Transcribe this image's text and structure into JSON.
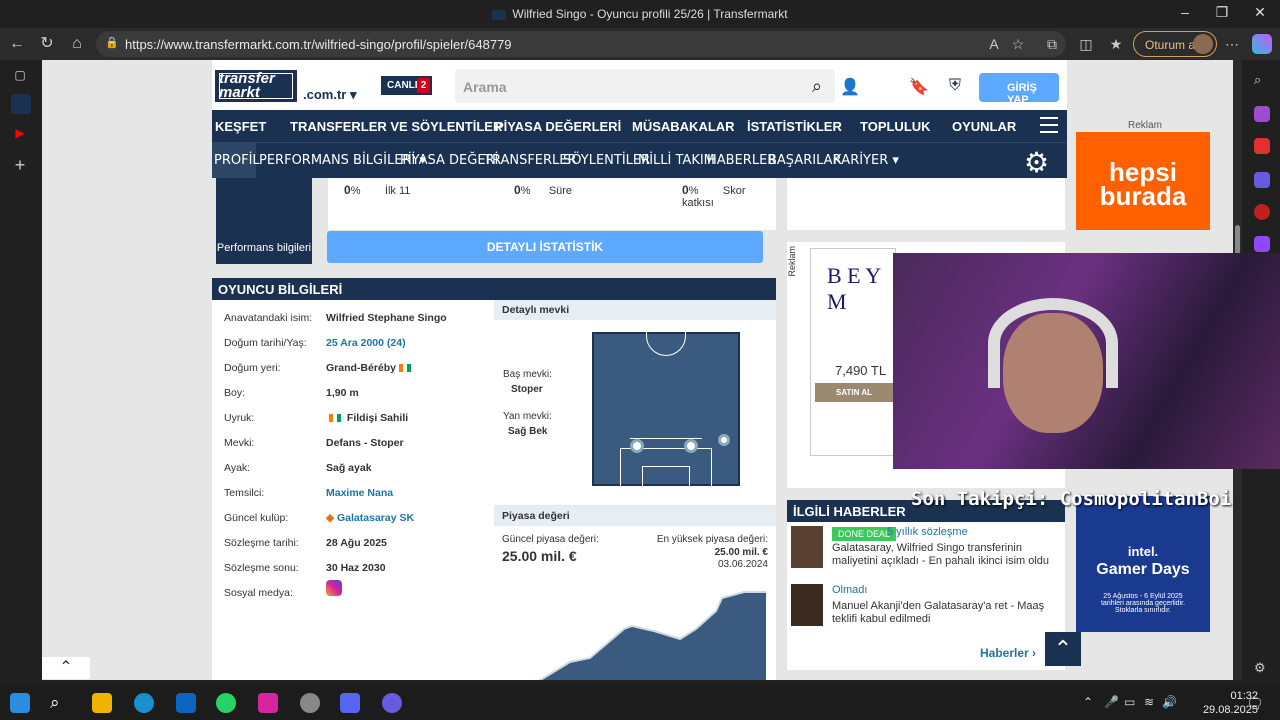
{
  "window": {
    "title": "Wilfried Singo - Oyuncu profili 25/26 | Transfermarkt"
  },
  "browser": {
    "url": "https://www.transfermarkt.com.tr/wilfried-singo/profil/spieler/648779",
    "signin_label": "Oturum aç"
  },
  "header": {
    "logo_line1": "transfer",
    "logo_line2": "markt",
    "domain": ".com.tr",
    "live_label": "CANLI",
    "live_count": "2",
    "search_placeholder": "Arama",
    "login_label": "GİRİŞ YAP"
  },
  "nav_primary": [
    "KEŞFET",
    "TRANSFERLER VE SÖYLENTİLER",
    "PİYASA DEĞERLERİ",
    "MÜSABAKALAR",
    "İSTATİSTİKLER",
    "TOPLULUK",
    "OYUNLAR"
  ],
  "nav_secondary": [
    "PROFİL",
    "PERFORMANS BİLGİLERİ ▾",
    "PİYASA DEĞERİ",
    "TRANSFERLER",
    "SÖYLENTİLER",
    "MİLLİ TAKIM",
    "HABERLER",
    "BAŞARILAR",
    "KARİYER ▾"
  ],
  "performance": {
    "box_label": "Performans bilgileri",
    "stats": [
      {
        "value": "0",
        "unit": "%",
        "label": "İlk 11"
      },
      {
        "value": "0",
        "unit": "%",
        "label": "Süre"
      },
      {
        "value": "0",
        "unit": "%",
        "label": "Skor katkısı"
      }
    ],
    "detail_button": "DETAYLI İSTATİSTİK"
  },
  "player_info": {
    "heading": "OYUNCU BİLGİLERİ",
    "rows": [
      {
        "label": "Anavatandaki isim:",
        "value": "Wilfried Stephane Singo"
      },
      {
        "label": "Doğum tarihi/Yaş:",
        "value": "25 Ara 2000 (24)"
      },
      {
        "label": "Doğum yeri:",
        "value": "Grand-Béréby"
      },
      {
        "label": "Boy:",
        "value": "1,90 m"
      },
      {
        "label": "Uyruk:",
        "value": "Fildişi Sahili"
      },
      {
        "label": "Mevki:",
        "value": "Defans - Stoper"
      },
      {
        "label": "Ayak:",
        "value": "Sağ ayak"
      },
      {
        "label": "Temsilci:",
        "value": "Maxime Nana"
      },
      {
        "label": "Güncel kulüp:",
        "value": "Galatasaray SK"
      },
      {
        "label": "Sözleşme tarihi:",
        "value": "28 Ağu 2025"
      },
      {
        "label": "Sözleşme sonu:",
        "value": "30 Haz 2030"
      },
      {
        "label": "Sosyal medya:",
        "value": ""
      }
    ]
  },
  "position": {
    "heading": "Detaylı mevki",
    "main_label": "Baş mevki:",
    "main_value": "Stoper",
    "side_label": "Yan mevki:",
    "side_value": "Sağ Bek"
  },
  "market_value": {
    "heading": "Piyasa değeri",
    "current_label": "Güncel piyasa değeri:",
    "current_value": "25.00 mil. €",
    "max_label": "En yüksek piyasa değeri:",
    "max_value": "25.00 mil. €",
    "max_date": "03.06.2024"
  },
  "ads": {
    "label": "Reklam",
    "side_label": "Reklam",
    "hb_line1": "hepsi",
    "hb_line2": "burada",
    "beymen": "B E Y M",
    "beymen_price": "7,490 TL",
    "beymen_buy": "SATIN AL",
    "intel_brand": "intel.",
    "intel_title": "Gamer Days",
    "intel_date": "25 Ağustos - 6 Eylül 2025",
    "intel_sub1": "tarihleri arasında geçerlidir.",
    "intel_sub2": "Stoklarla sınırlıdır."
  },
  "news": {
    "heading": "İLGİLİ HABERLER",
    "items": [
      {
        "badge": "DONE DEAL",
        "tag": "5 yıllık sözleşme",
        "title": "Galatasaray, Wilfried Singo transferinin maliyetini açıkladı - En pahalı ikinci isim oldu"
      },
      {
        "badge": "",
        "tag": "Olmadı",
        "title": "Manuel Akanji'den Galatasaray'a ret - Maaş teklifi kabul edilmedi"
      }
    ],
    "more": "Haberler"
  },
  "stream_overlay": "Son Takipçi: CosmopolitanBoi",
  "taskbar": {
    "time": "01:32",
    "date": "29.08.2025"
  }
}
